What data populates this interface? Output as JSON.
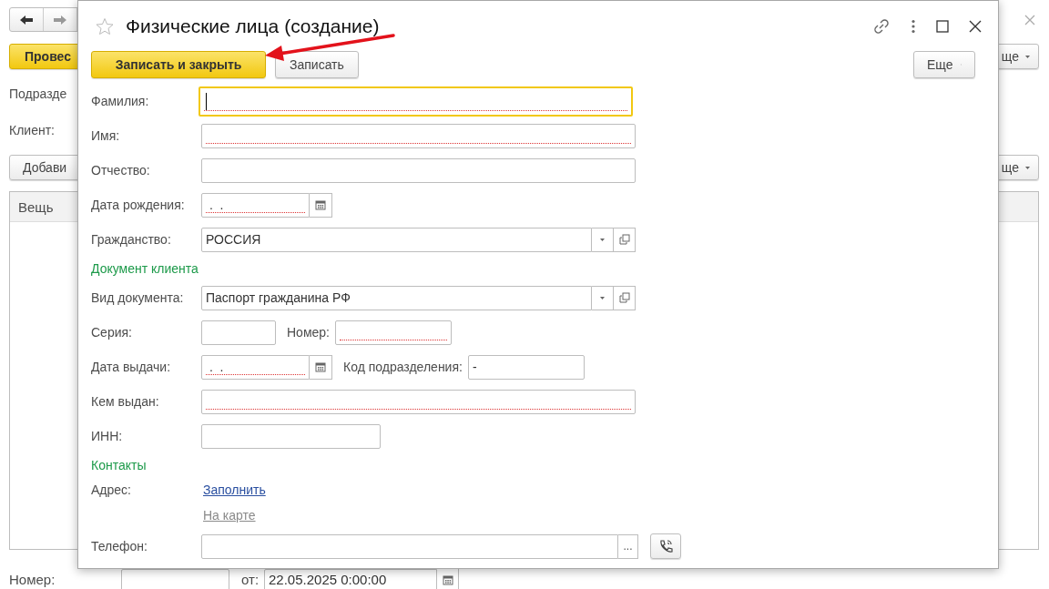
{
  "background": {
    "post_button": "Провес",
    "subdivision_label": "Подразде",
    "client_label": "Клиент:",
    "add_button": "Добави",
    "more_buttons": [
      "ще",
      "ще"
    ],
    "table": {
      "columns": [
        "Вещь"
      ]
    },
    "number_label": "Номер:",
    "date_label": "от:",
    "date_value": "22.05.2025 0:00:00"
  },
  "dialog": {
    "title": "Физические лица (создание)",
    "favorite": false,
    "buttons": [
      {
        "label": "Записать и закрыть",
        "kind": "primary"
      },
      {
        "label": "Записать",
        "kind": "default"
      }
    ],
    "more_button": "Еще",
    "rows": [
      {
        "kind": "text",
        "label": "Фамилия:",
        "required": true,
        "focused": true
      },
      {
        "kind": "text",
        "label": "Имя:",
        "required": true,
        "focused": false
      },
      {
        "kind": "text",
        "label": "Отчество:",
        "required": false,
        "focused": false
      },
      {
        "kind": "date",
        "label": "Дата рождения:",
        "value": " .  . ",
        "required": true
      },
      {
        "kind": "select",
        "label": "Гражданство:",
        "value": "РОССИЯ"
      },
      {
        "kind": "section",
        "label": "Документ клиента"
      },
      {
        "kind": "select",
        "label": "Вид документа:",
        "value": "Паспорт гражданина РФ"
      },
      {
        "kind": "pair",
        "label": "Серия:",
        "first": {
          "kind": "text",
          "required": false
        },
        "second_label": "Номер:",
        "second": {
          "kind": "text",
          "required": true
        }
      },
      {
        "kind": "pair",
        "label": "Дата выдачи:",
        "first": {
          "kind": "date",
          "value": " .  . ",
          "required": true
        },
        "second_label": "Код подразделения:",
        "second": {
          "kind": "text",
          "value": "-",
          "required": false
        }
      },
      {
        "kind": "text",
        "label": "Кем выдан:",
        "required": true,
        "focused": false
      },
      {
        "kind": "short",
        "label": "ИНН:",
        "required": false,
        "focused": false
      },
      {
        "kind": "section",
        "label": "Контакты"
      },
      {
        "kind": "links",
        "label": "Адрес:",
        "links": [
          {
            "text": "Заполнить",
            "disabled": false
          },
          {
            "text": "На карте",
            "disabled": true
          }
        ]
      },
      {
        "kind": "phone",
        "label": "Телефон:",
        "button": "..."
      }
    ]
  }
}
